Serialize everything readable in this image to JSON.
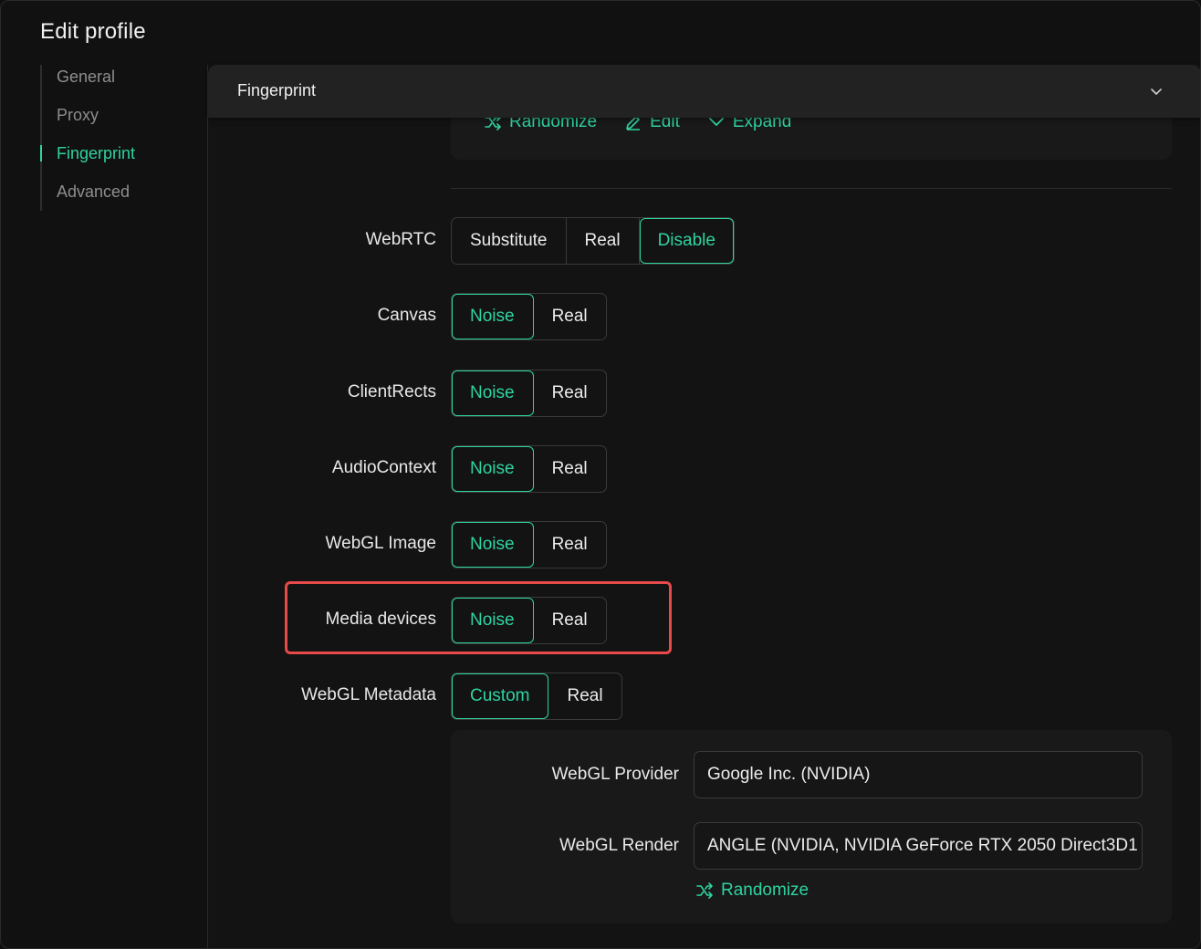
{
  "page": {
    "title": "Edit profile"
  },
  "nav": {
    "items": [
      {
        "label": "General",
        "active": false
      },
      {
        "label": "Proxy",
        "active": false
      },
      {
        "label": "Fingerprint",
        "active": true
      },
      {
        "label": "Advanced",
        "active": false
      }
    ]
  },
  "section": {
    "title": "Fingerprint",
    "top_actions": {
      "randomize": "Randomize",
      "edit": "Edit",
      "expand": "Expand"
    }
  },
  "settings": [
    {
      "label": "WebRTC",
      "options": [
        "Substitute",
        "Real",
        "Disable"
      ],
      "selected": "Disable"
    },
    {
      "label": "Canvas",
      "options": [
        "Noise",
        "Real"
      ],
      "selected": "Noise"
    },
    {
      "label": "ClientRects",
      "options": [
        "Noise",
        "Real"
      ],
      "selected": "Noise"
    },
    {
      "label": "AudioContext",
      "options": [
        "Noise",
        "Real"
      ],
      "selected": "Noise"
    },
    {
      "label": "WebGL Image",
      "options": [
        "Noise",
        "Real"
      ],
      "selected": "Noise"
    },
    {
      "label": "Media devices",
      "options": [
        "Noise",
        "Real"
      ],
      "selected": "Noise",
      "highlighted": true
    },
    {
      "label": "WebGL Metadata",
      "options": [
        "Custom",
        "Real"
      ],
      "selected": "Custom"
    }
  ],
  "webgl": {
    "provider_label": "WebGL Provider",
    "provider_value": "Google Inc. (NVIDIA)",
    "render_label": "WebGL Render",
    "render_value": "ANGLE (NVIDIA, NVIDIA GeForce RTX 2050 Direct3D1",
    "randomize": "Randomize"
  },
  "colors": {
    "accent": "#2ed3a0",
    "highlight": "#e84a4a",
    "background": "#111111"
  }
}
